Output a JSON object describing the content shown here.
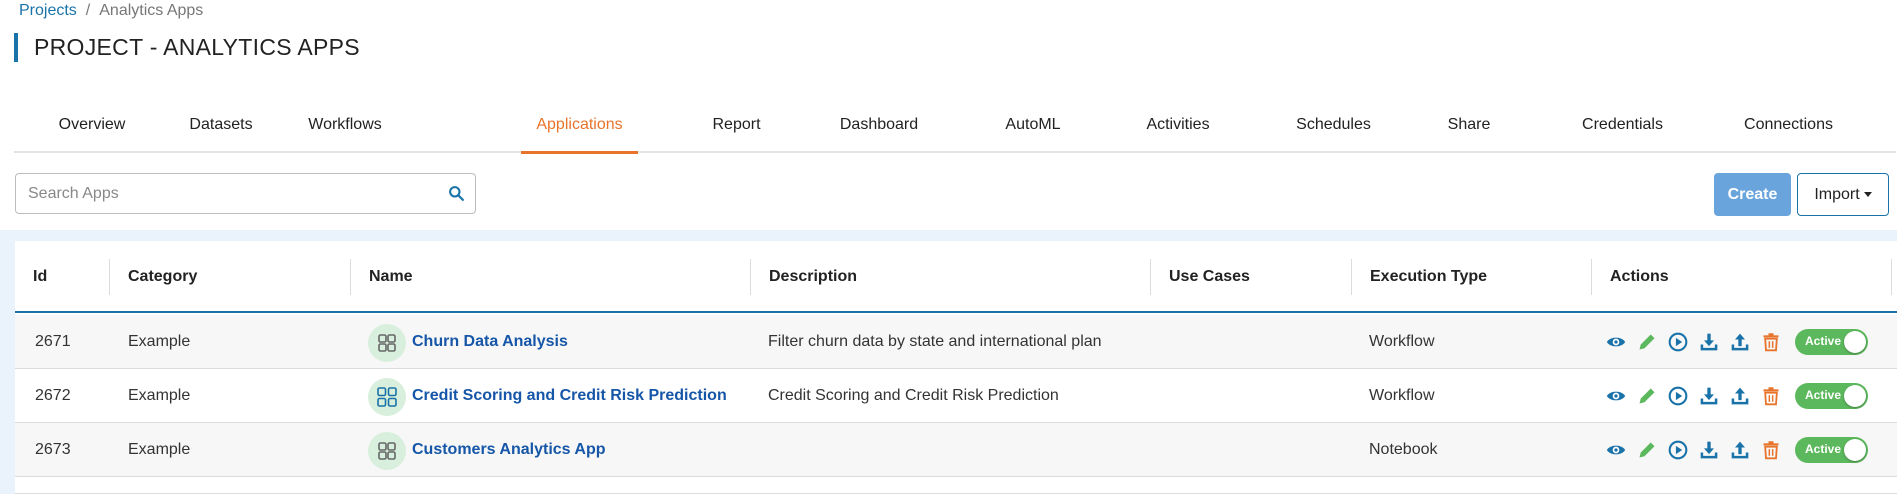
{
  "breadcrumb": {
    "root": "Projects",
    "separator": "/",
    "current": "Analytics Apps"
  },
  "page_title": "PROJECT - ANALYTICS APPS",
  "tabs": [
    {
      "label": "Overview"
    },
    {
      "label": "Datasets"
    },
    {
      "label": "Workflows"
    },
    {
      "label": "Applications",
      "active": true
    },
    {
      "label": "Report"
    },
    {
      "label": "Dashboard"
    },
    {
      "label": "AutoML"
    },
    {
      "label": "Activities"
    },
    {
      "label": "Schedules"
    },
    {
      "label": "Share"
    },
    {
      "label": "Credentials"
    },
    {
      "label": "Connections"
    }
  ],
  "search": {
    "placeholder": "Search Apps",
    "value": ""
  },
  "toolbar": {
    "create_label": "Create",
    "import_label": "Import"
  },
  "table": {
    "columns": [
      "Id",
      "Category",
      "Name",
      "Description",
      "Use Cases",
      "Execution Type",
      "Actions"
    ],
    "rows": [
      {
        "id": "2671",
        "category": "Example",
        "name": "Churn Data Analysis",
        "description": "Filter churn data by state and international plan",
        "use_cases": "",
        "execution_type": "Workflow",
        "status": "Active"
      },
      {
        "id": "2672",
        "category": "Example",
        "name": "Credit Scoring and Credit Risk Prediction",
        "description": "Credit Scoring and Credit Risk Prediction",
        "use_cases": "",
        "execution_type": "Workflow",
        "status": "Active"
      },
      {
        "id": "2673",
        "category": "Example",
        "name": "Customers Analytics App",
        "description": "",
        "use_cases": "",
        "execution_type": "Notebook",
        "status": "Active"
      }
    ]
  },
  "colors": {
    "accent": "#1a73a8",
    "active_tab": "#e8742c",
    "create_button": "#6aa4dc",
    "toggle_active": "#5cb85c",
    "link": "#1556a8",
    "edit_icon": "#5cb85c",
    "delete_icon": "#e8742c"
  },
  "icons": [
    "search-icon",
    "app-icon",
    "view-icon",
    "edit-icon",
    "run-icon",
    "download-icon",
    "upload-icon",
    "delete-icon"
  ]
}
